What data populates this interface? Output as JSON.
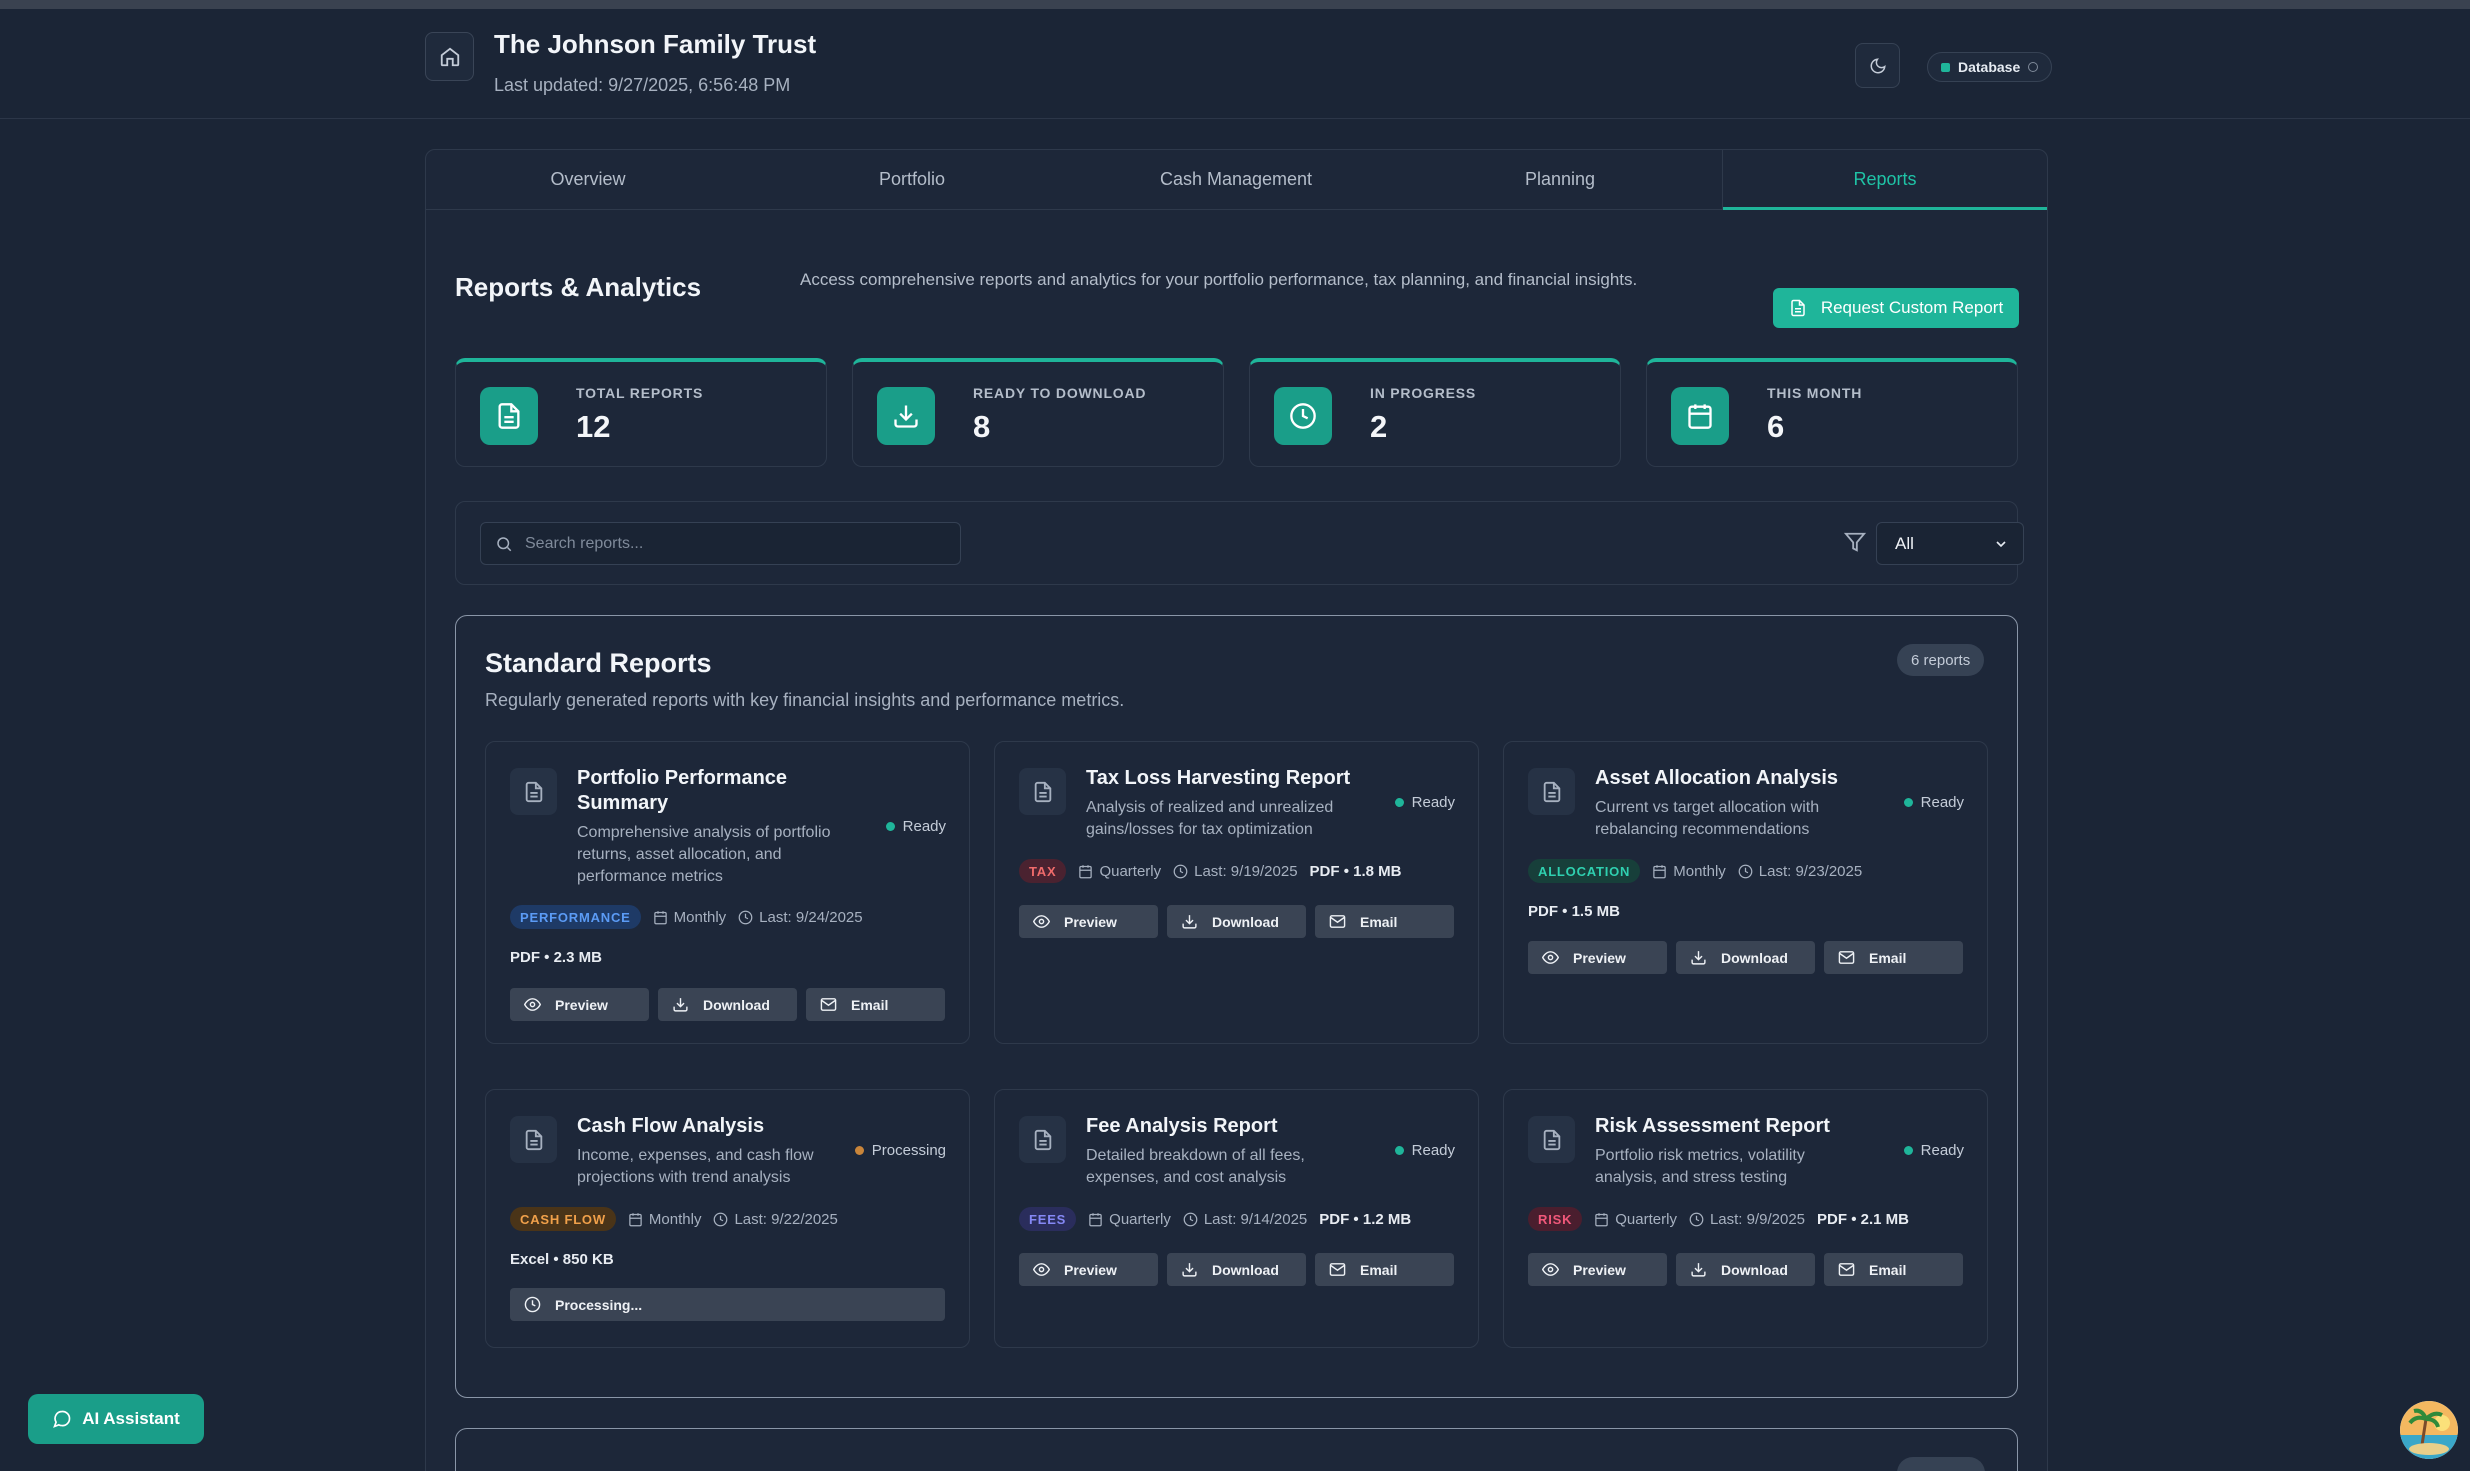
{
  "header": {
    "title": "The Johnson Family Trust",
    "last_updated": "Last updated: 9/27/2025, 6:56:48 PM",
    "db_label": "Database"
  },
  "tabs": [
    "Overview",
    "Portfolio",
    "Cash Management",
    "Planning",
    "Reports"
  ],
  "active_tab": "Reports",
  "reports_section": {
    "title": "Reports & Analytics",
    "description": "Access comprehensive reports and analytics for your portfolio performance, tax planning, and financial insights.",
    "request_button": "Request Custom Report"
  },
  "stats": [
    {
      "label": "TOTAL REPORTS",
      "value": "12",
      "icon": "document-icon"
    },
    {
      "label": "READY TO DOWNLOAD",
      "value": "8",
      "icon": "download-icon"
    },
    {
      "label": "IN PROGRESS",
      "value": "2",
      "icon": "clock-icon"
    },
    {
      "label": "THIS MONTH",
      "value": "6",
      "icon": "calendar-icon"
    }
  ],
  "search": {
    "placeholder": "Search reports...",
    "filter_value": "All"
  },
  "standard_reports": {
    "title": "Standard Reports",
    "subtitle": "Regularly generated reports with key financial insights and performance metrics.",
    "count": "6 reports",
    "cards": [
      {
        "title": "Portfolio Performance Summary",
        "description": "Comprehensive analysis of portfolio returns, asset allocation, and performance metrics",
        "status": "Ready",
        "tag": "PERFORMANCE",
        "frequency": "Monthly",
        "last": "Last: 9/24/2025",
        "format": "PDF • 2.3 MB"
      },
      {
        "title": "Tax Loss Harvesting Report",
        "description": "Analysis of realized and unrealized gains/losses for tax optimization",
        "status": "Ready",
        "tag": "TAX",
        "frequency": "Quarterly",
        "last": "Last: 9/19/2025",
        "format": "PDF • 1.8 MB"
      },
      {
        "title": "Asset Allocation Analysis",
        "description": "Current vs target allocation with rebalancing recommendations",
        "status": "Ready",
        "tag": "ALLOCATION",
        "frequency": "Monthly",
        "last": "Last: 9/23/2025",
        "format": "PDF • 1.5 MB"
      },
      {
        "title": "Cash Flow Analysis",
        "description": "Income, expenses, and cash flow projections with trend analysis",
        "status": "Processing",
        "tag": "CASH FLOW",
        "frequency": "Monthly",
        "last": "Last: 9/22/2025",
        "format": "Excel • 850 KB",
        "processing_label": "Processing..."
      },
      {
        "title": "Fee Analysis Report",
        "description": "Detailed breakdown of all fees, expenses, and cost analysis",
        "status": "Ready",
        "tag": "FEES",
        "frequency": "Quarterly",
        "last": "Last: 9/14/2025",
        "format": "PDF • 1.2 MB"
      },
      {
        "title": "Risk Assessment Report",
        "description": "Portfolio risk metrics, volatility analysis, and stress testing",
        "status": "Ready",
        "tag": "RISK",
        "frequency": "Quarterly",
        "last": "Last: 9/9/2025",
        "format": "PDF • 2.1 MB"
      }
    ],
    "actions": {
      "preview": "Preview",
      "download": "Download",
      "email": "Email"
    }
  },
  "ai_assistant": "AI Assistant",
  "colors": {
    "accent": "#1fb59a",
    "background": "#1b2536",
    "ready": "#1fb59a",
    "processing": "#c9853a",
    "tag_performance": "#3b82f6",
    "tag_tax": "#e05a5a",
    "tag_allocation": "#1fb59a",
    "tag_cashflow": "#e0913a",
    "tag_fees": "#6366f1",
    "tag_risk": "#e04a6a"
  }
}
